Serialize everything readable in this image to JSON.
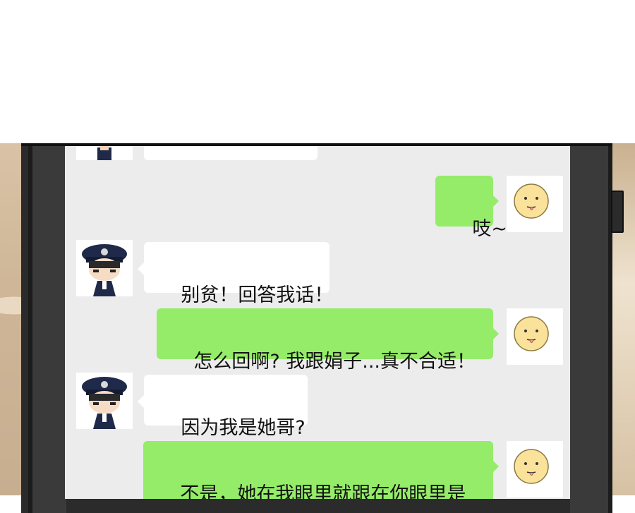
{
  "chat": {
    "messages": [
      {
        "sender": "self",
        "text": "吱~"
      },
      {
        "sender": "other",
        "text": "别贫！回答我话！"
      },
      {
        "sender": "self",
        "text": "怎么回啊? 我跟娟子...真不合适！"
      },
      {
        "sender": "other",
        "text": "因为我是她哥?"
      },
      {
        "sender": "self",
        "text": "不是，她在我眼里就跟在你眼里是\n一样的，明白不?"
      }
    ]
  },
  "avatars": {
    "other": {
      "icon": "police-officer-avatar-icon"
    },
    "self": {
      "icon": "smiley-face-avatar-icon"
    }
  },
  "colors": {
    "chat_background": "#ececec",
    "self_bubble": "#95ec69",
    "other_bubble": "#ffffff",
    "phone_frame": "#2b2b2b"
  }
}
